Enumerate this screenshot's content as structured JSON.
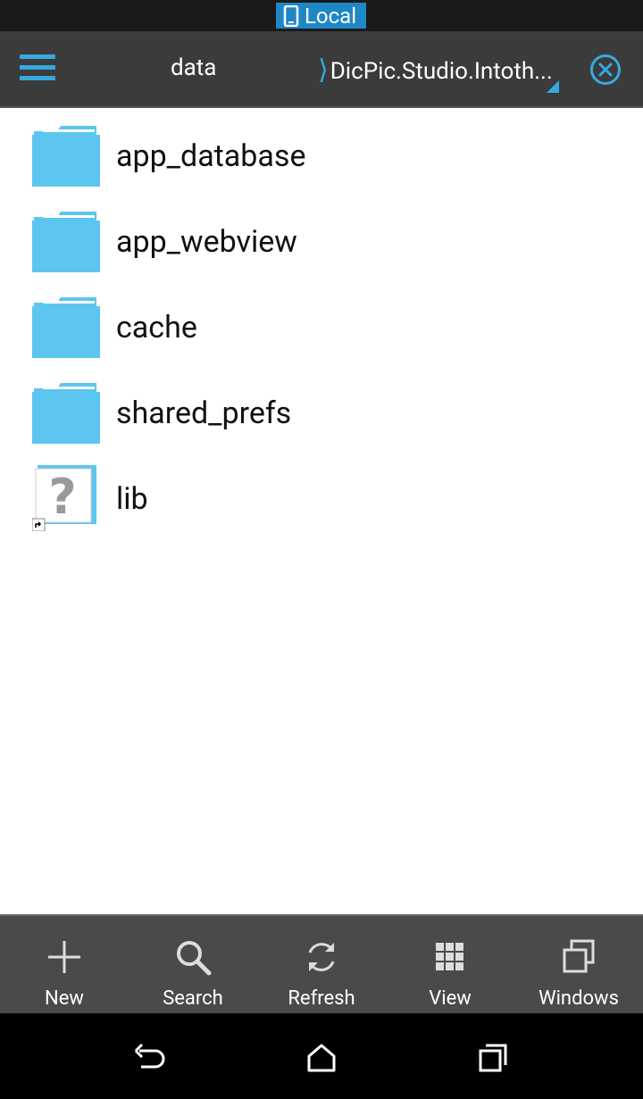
{
  "status_bar": {
    "location_label": "Local"
  },
  "toolbar": {
    "path_root": "data",
    "path_current": "DicPic.Studio.Intoth...",
    "accent_color": "#36a9e1"
  },
  "files": [
    {
      "name": "app_database",
      "type": "folder",
      "icon": "folder-icon"
    },
    {
      "name": "app_webview",
      "type": "folder",
      "icon": "folder-icon"
    },
    {
      "name": "cache",
      "type": "folder",
      "icon": "folder-icon"
    },
    {
      "name": "shared_prefs",
      "type": "folder",
      "icon": "folder-icon"
    },
    {
      "name": "lib",
      "type": "unknown-shortcut",
      "icon": "unknown-file-icon"
    }
  ],
  "bottom_toolbar": {
    "new": "New",
    "search": "Search",
    "refresh": "Refresh",
    "view": "View",
    "windows": "Windows"
  },
  "nav_bar": {
    "buttons": [
      "back-icon",
      "home-icon",
      "recents-icon"
    ]
  }
}
